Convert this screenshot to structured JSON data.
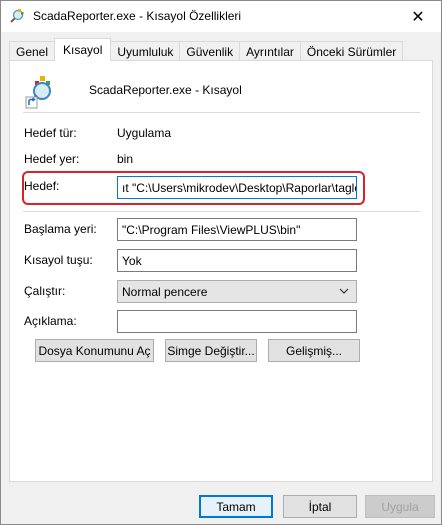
{
  "window": {
    "title": "ScadaReporter.exe - Kısayol Özellikleri",
    "close_glyph": "✕"
  },
  "tabs": [
    {
      "label": "Genel",
      "active": false
    },
    {
      "label": "Kısayol",
      "active": true
    },
    {
      "label": "Uyumluluk",
      "active": false
    },
    {
      "label": "Güvenlik",
      "active": false
    },
    {
      "label": "Ayrıntılar",
      "active": false
    },
    {
      "label": "Önceki Sürümler",
      "active": false
    }
  ],
  "shortcut": {
    "name": "ScadaReporter.exe - Kısayol"
  },
  "fields": {
    "target_type_label": "Hedef tür:",
    "target_type_value": "Uygulama",
    "target_location_label": "Hedef yer:",
    "target_location_value": "bin",
    "target_label": "Hedef:",
    "target_value": "ıt \"C:\\Users\\mikrodev\\Desktop\\Raporlar\\taglog\"",
    "start_in_label": "Başlama yeri:",
    "start_in_value": "\"C:\\Program Files\\ViewPLUS\\bin\"",
    "shortcut_key_label": "Kısayol tuşu:",
    "shortcut_key_value": "Yok",
    "run_label": "Çalıştır:",
    "run_value": "Normal pencere",
    "comment_label": "Açıklama:",
    "comment_value": ""
  },
  "buttons": {
    "open_location": "Dosya Konumunu Aç",
    "change_icon": "Simge Değiştir...",
    "advanced": "Gelişmiş...",
    "ok": "Tamam",
    "cancel": "İptal",
    "apply": "Uygula"
  },
  "colors": {
    "highlight": "#d9232a",
    "focus": "#0078d7"
  }
}
